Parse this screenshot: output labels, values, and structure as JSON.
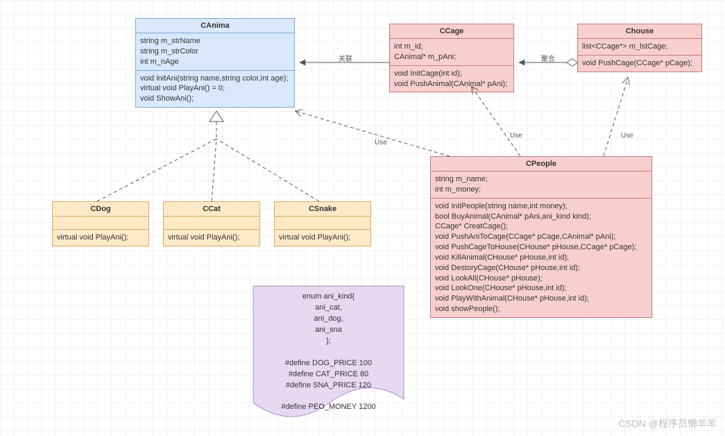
{
  "classes": {
    "canima": {
      "title": "CAnima",
      "attrs": [
        "string m_strName",
        "string m_strColor",
        "int m_nAge"
      ],
      "ops": [
        "void initAni(string name,string color,int age);",
        "virtual void PlayAni() = 0;",
        "void ShowAni();"
      ]
    },
    "cdog": {
      "title": "CDog",
      "ops": [
        "virtual void PlayAni();"
      ]
    },
    "ccat": {
      "title": "CCat",
      "ops": [
        "virtual void PlayAni();"
      ]
    },
    "csnake": {
      "title": "CSnake",
      "ops": [
        "virtual void PlayAni();"
      ]
    },
    "ccage": {
      "title": "CCage",
      "attrs": [
        "int m_id;",
        "CAnimal* m_pAni;"
      ],
      "ops": [
        "void InitCage(int id);",
        "void PushAnimal(CAnimal* pAni);"
      ]
    },
    "chouse": {
      "title": "Chouse",
      "attrs": [
        "list<CCage*> m_lstCage;"
      ],
      "ops": [
        "void PushCage(CCage* pCage);"
      ]
    },
    "cpeople": {
      "title": "CPeople",
      "attrs": [
        "string m_name;",
        "int m_money;"
      ],
      "ops": [
        "void InitPeople(string name,int money);",
        "bool BuyAnimal(CAnimal* pAni,ani_kind kind);",
        "CCage* CreatCage();",
        "void PushAniToCage(CCage* pCage,CAnimal* pAni);",
        "void PushCageToHouse(CHouse* pHouse,CCage* pCage);",
        "void KillAnimal(CHouse* pHouse,int id);",
        "void DestoryCage(CHouse* pHouse,int id);",
        "void LookAll(CHouse* pHouse);",
        "void LookOne(CHouse* pHouse,int id);",
        "void PlayWithAnimal(CHouse* pHouse,int id);",
        "void showPeople();"
      ]
    }
  },
  "note_lines": [
    "enum ani_kind{",
    "ani_cat,",
    "ani_dog,",
    "ani_sna",
    "};",
    "",
    "#define DOG_PRICE 100",
    "#define CAT_PRICE 80",
    "#define SNA_PRICE 120",
    "",
    "#define PEO_MONEY 1200"
  ],
  "rel_labels": {
    "assoc": "关联",
    "aggr": "聚合",
    "use": "Use"
  },
  "watermark": "CSDN @程序员懒羊羊",
  "chart_data": {
    "type": "table",
    "description": "UML class diagram",
    "classes": [
      {
        "name": "CAnima",
        "stereotype": "abstract",
        "attrs": [
          "string m_strName",
          "string m_strColor",
          "int m_nAge"
        ],
        "ops": [
          "void initAni(string name,string color,int age)",
          "virtual void PlayAni() = 0",
          "void ShowAni()"
        ]
      },
      {
        "name": "CDog",
        "ops": [
          "virtual void PlayAni()"
        ]
      },
      {
        "name": "CCat",
        "ops": [
          "virtual void PlayAni()"
        ]
      },
      {
        "name": "CSnake",
        "ops": [
          "virtual void PlayAni()"
        ]
      },
      {
        "name": "CCage",
        "attrs": [
          "int m_id",
          "CAnimal* m_pAni"
        ],
        "ops": [
          "void InitCage(int id)",
          "void PushAnimal(CAnimal* pAni)"
        ]
      },
      {
        "name": "Chouse",
        "attrs": [
          "list<CCage*> m_lstCage"
        ],
        "ops": [
          "void PushCage(CCage* pCage)"
        ]
      },
      {
        "name": "CPeople",
        "attrs": [
          "string m_name",
          "int m_money"
        ],
        "ops": [
          "void InitPeople(string name,int money)",
          "bool BuyAnimal(CAnimal* pAni,ani_kind kind)",
          "CCage* CreatCage()",
          "void PushAniToCage(CCage* pCage,CAnimal* pAni)",
          "void PushCageToHouse(CHouse* pHouse,CCage* pCage)",
          "void KillAnimal(CHouse* pHouse,int id)",
          "void DestoryCage(CHouse* pHouse,int id)",
          "void LookAll(CHouse* pHouse)",
          "void LookOne(CHouse* pHouse,int id)",
          "void PlayWithAnimal(CHouse* pHouse,int id)",
          "void showPeople()"
        ]
      }
    ],
    "relations": [
      {
        "from": "CDog",
        "to": "CAnima",
        "type": "generalization"
      },
      {
        "from": "CCat",
        "to": "CAnima",
        "type": "generalization"
      },
      {
        "from": "CSnake",
        "to": "CAnima",
        "type": "generalization"
      },
      {
        "from": "CCage",
        "to": "CAnima",
        "type": "association",
        "label": "关联"
      },
      {
        "from": "Chouse",
        "to": "CCage",
        "type": "aggregation",
        "label": "聚合"
      },
      {
        "from": "CPeople",
        "to": "CAnima",
        "type": "dependency",
        "label": "Use"
      },
      {
        "from": "CPeople",
        "to": "CCage",
        "type": "dependency",
        "label": "Use"
      },
      {
        "from": "CPeople",
        "to": "Chouse",
        "type": "dependency",
        "label": "Use"
      }
    ],
    "note": "enum ani_kind{ ani_cat, ani_dog, ani_sna }; #define DOG_PRICE 100; #define CAT_PRICE 80; #define SNA_PRICE 120; #define PEO_MONEY 1200"
  }
}
